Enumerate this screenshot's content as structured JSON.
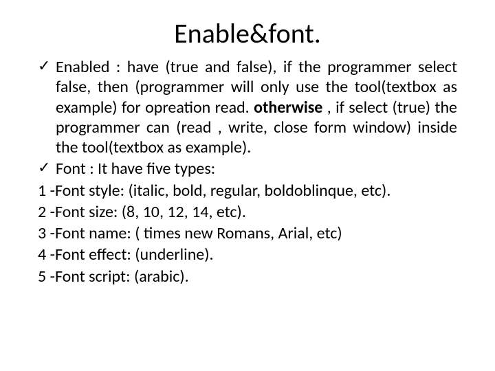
{
  "title": "Enable&font.",
  "enabled_label": "Enabled",
  "enabled_text_a": " : have (true and false), if the programmer select false, then (programmer will only use the tool(textbox as example) for opreation read. ",
  "enabled_bold": "otherwise",
  "enabled_text_b": " , if select (true) the programmer can (read , write, close form window) inside the tool(textbox as example).",
  "font_label": "Font",
  "font_text": " : It have five types:",
  "line1": "1 -Font style: (italic, bold, regular, boldoblinque, etc).",
  "line2": "2 -Font size: (8, 10, 12, 14, etc).",
  "line3": "3 -Font name: ( times new Romans, Arial, etc)",
  "line4": "4 -Font effect: (underline).",
  "line5": "5 -Font script: (arabic)."
}
